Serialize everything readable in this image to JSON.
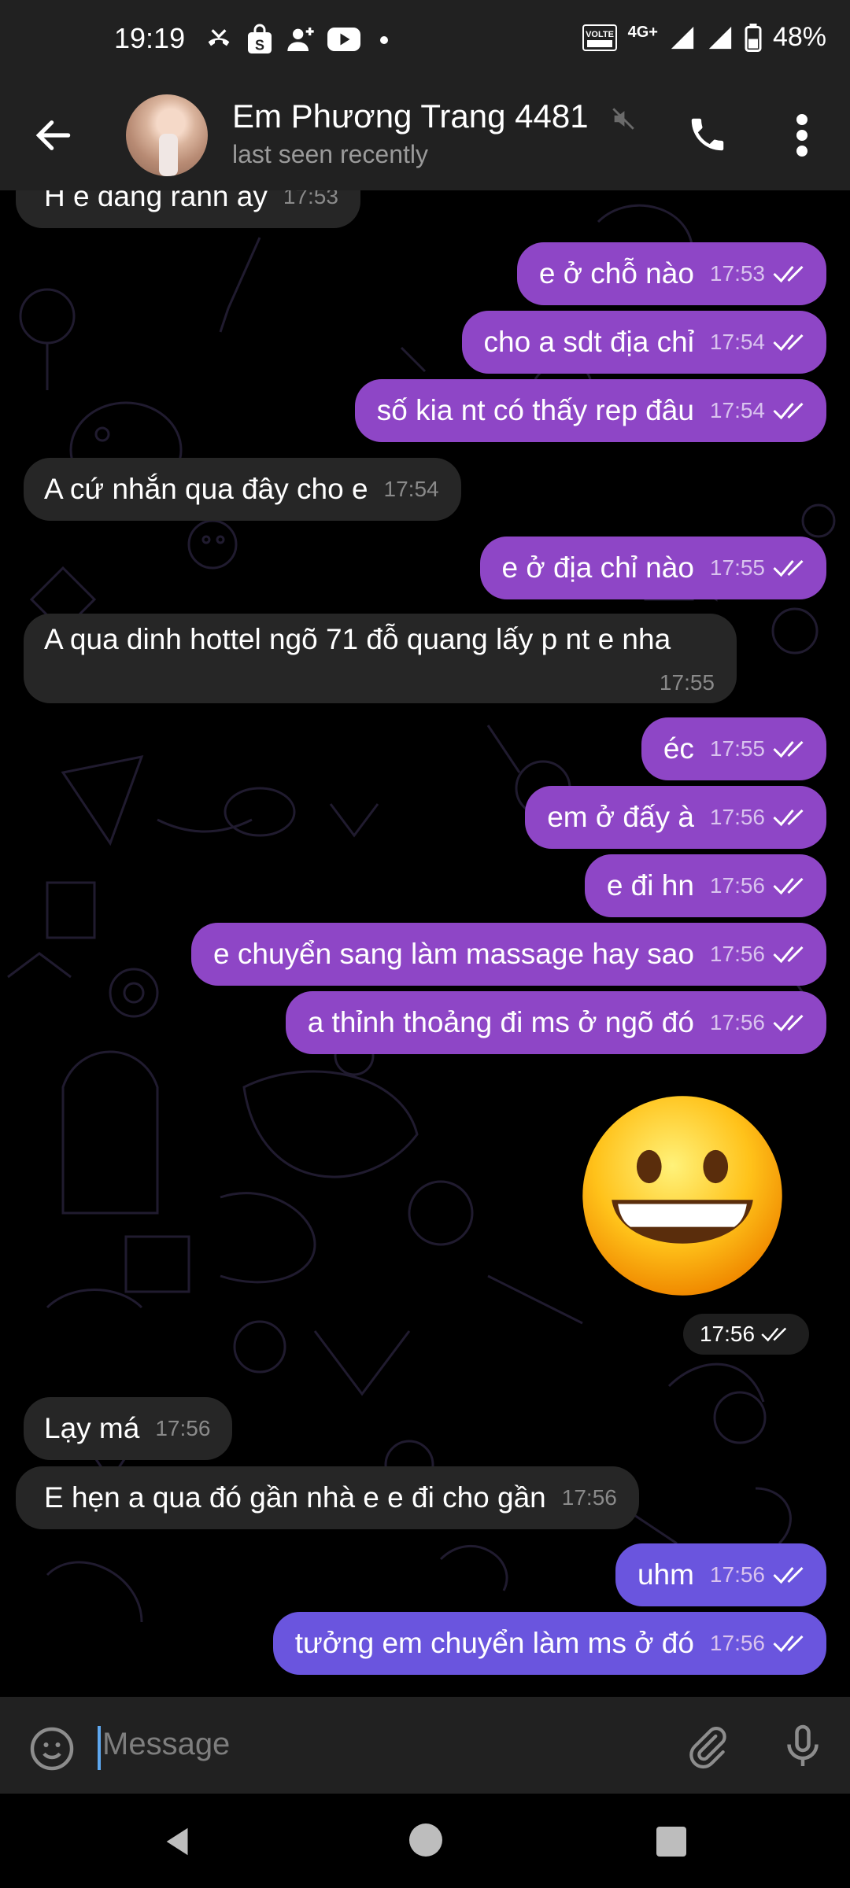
{
  "status_bar": {
    "time": "19:19",
    "network": "4G+",
    "battery": "48%",
    "volte": "VOLTE"
  },
  "header": {
    "name": "Em Phương Trang 4481",
    "status": "last seen recently"
  },
  "messages": [
    {
      "dir": "in",
      "text": "H e đang rảnh ấy",
      "time": "17:53"
    },
    {
      "dir": "out",
      "text": "e ở chỗ nào",
      "time": "17:53"
    },
    {
      "dir": "out",
      "text": "cho a sdt địa chỉ",
      "time": "17:54"
    },
    {
      "dir": "out",
      "text": "số kia nt có thấy rep đâu",
      "time": "17:54"
    },
    {
      "dir": "in",
      "text": "A cứ nhắn qua đây cho e",
      "time": "17:54"
    },
    {
      "dir": "out",
      "text": "e ở địa chỉ nào",
      "time": "17:55"
    },
    {
      "dir": "in",
      "text": "A qua dinh hottel ngõ 71 đỗ quang lấy p nt e nha",
      "time": "17:55"
    },
    {
      "dir": "out",
      "text": "éc",
      "time": "17:55"
    },
    {
      "dir": "out",
      "text": "em ở đấy à",
      "time": "17:56"
    },
    {
      "dir": "out",
      "text": "e đi hn",
      "time": "17:56"
    },
    {
      "dir": "out",
      "text": "e chuyển sang làm massage hay sao",
      "time": "17:56"
    },
    {
      "dir": "out",
      "text": "a thỉnh thoảng đi ms ở ngõ đó",
      "time": "17:56"
    },
    {
      "dir": "out",
      "sticker": "grinning-face-emoji",
      "time": "17:56"
    },
    {
      "dir": "in",
      "text": "Lạy má",
      "time": "17:56"
    },
    {
      "dir": "in",
      "text": "E hẹn a qua đó gần nhà e e đi cho gần",
      "time": "17:56"
    },
    {
      "dir": "out",
      "text": "uhm",
      "time": "17:56"
    },
    {
      "dir": "out",
      "text": "tưởng em chuyển làm ms ở đó",
      "time": "17:56"
    }
  ],
  "input": {
    "placeholder": "Message"
  },
  "colors": {
    "bar_bg": "#212121",
    "incoming_bubble": "#262626",
    "outgoing_bubble": "#8e46c6",
    "outgoing_bubble_last": "#6a55de",
    "chat_bg": "#000000"
  }
}
